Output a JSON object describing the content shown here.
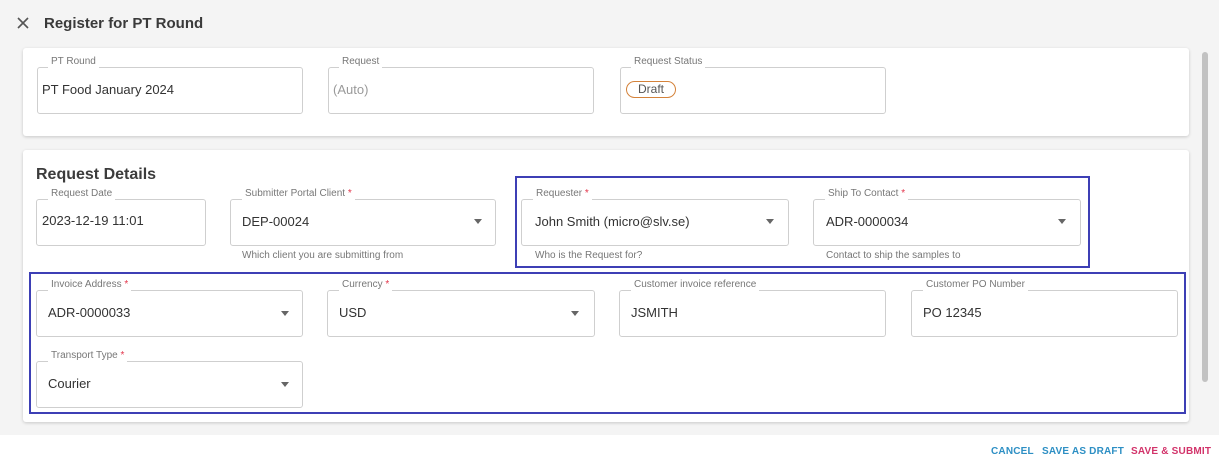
{
  "dialog": {
    "title": "Register for PT Round",
    "close_icon": "close-icon"
  },
  "summary": {
    "pt_round": {
      "label": "PT Round",
      "value": "PT Food January 2024"
    },
    "request": {
      "label": "Request",
      "placeholder": "(Auto)"
    },
    "request_status": {
      "label": "Request Status",
      "value": "Draft"
    }
  },
  "details": {
    "section_title": "Request Details",
    "request_date": {
      "label": "Request Date",
      "value": "2023-12-19 11:01"
    },
    "submitter_portal_client": {
      "label": "Submitter Portal Client",
      "required": "*",
      "value": "DEP-00024",
      "helper": "Which client you are submitting from"
    },
    "requester": {
      "label": "Requester",
      "required": "*",
      "value": "John Smith (micro@slv.se)",
      "helper": "Who is the Request for?"
    },
    "ship_to_contact": {
      "label": "Ship To Contact",
      "required": "*",
      "value": "ADR-0000034",
      "helper": "Contact to ship the samples to"
    },
    "invoice_address": {
      "label": "Invoice Address",
      "required": "*",
      "value": "ADR-0000033"
    },
    "currency": {
      "label": "Currency",
      "required": "*",
      "value": "USD"
    },
    "customer_invoice_reference": {
      "label": "Customer invoice reference",
      "value": "JSMITH"
    },
    "customer_po_number": {
      "label": "Customer PO Number",
      "value": "PO 12345"
    },
    "transport_type": {
      "label": "Transport Type",
      "required": "*",
      "value": "Courier"
    }
  },
  "actions": {
    "cancel": "CANCEL",
    "save_as_draft": "SAVE AS DRAFT",
    "save_submit": "SAVE & SUBMIT"
  },
  "colors": {
    "highlight_border": "#3d3fb5",
    "status_pill_border": "#d4823a",
    "action_primary": "#2d8fc4",
    "action_submit": "#d2336a",
    "required_marker": "#e3344a"
  }
}
